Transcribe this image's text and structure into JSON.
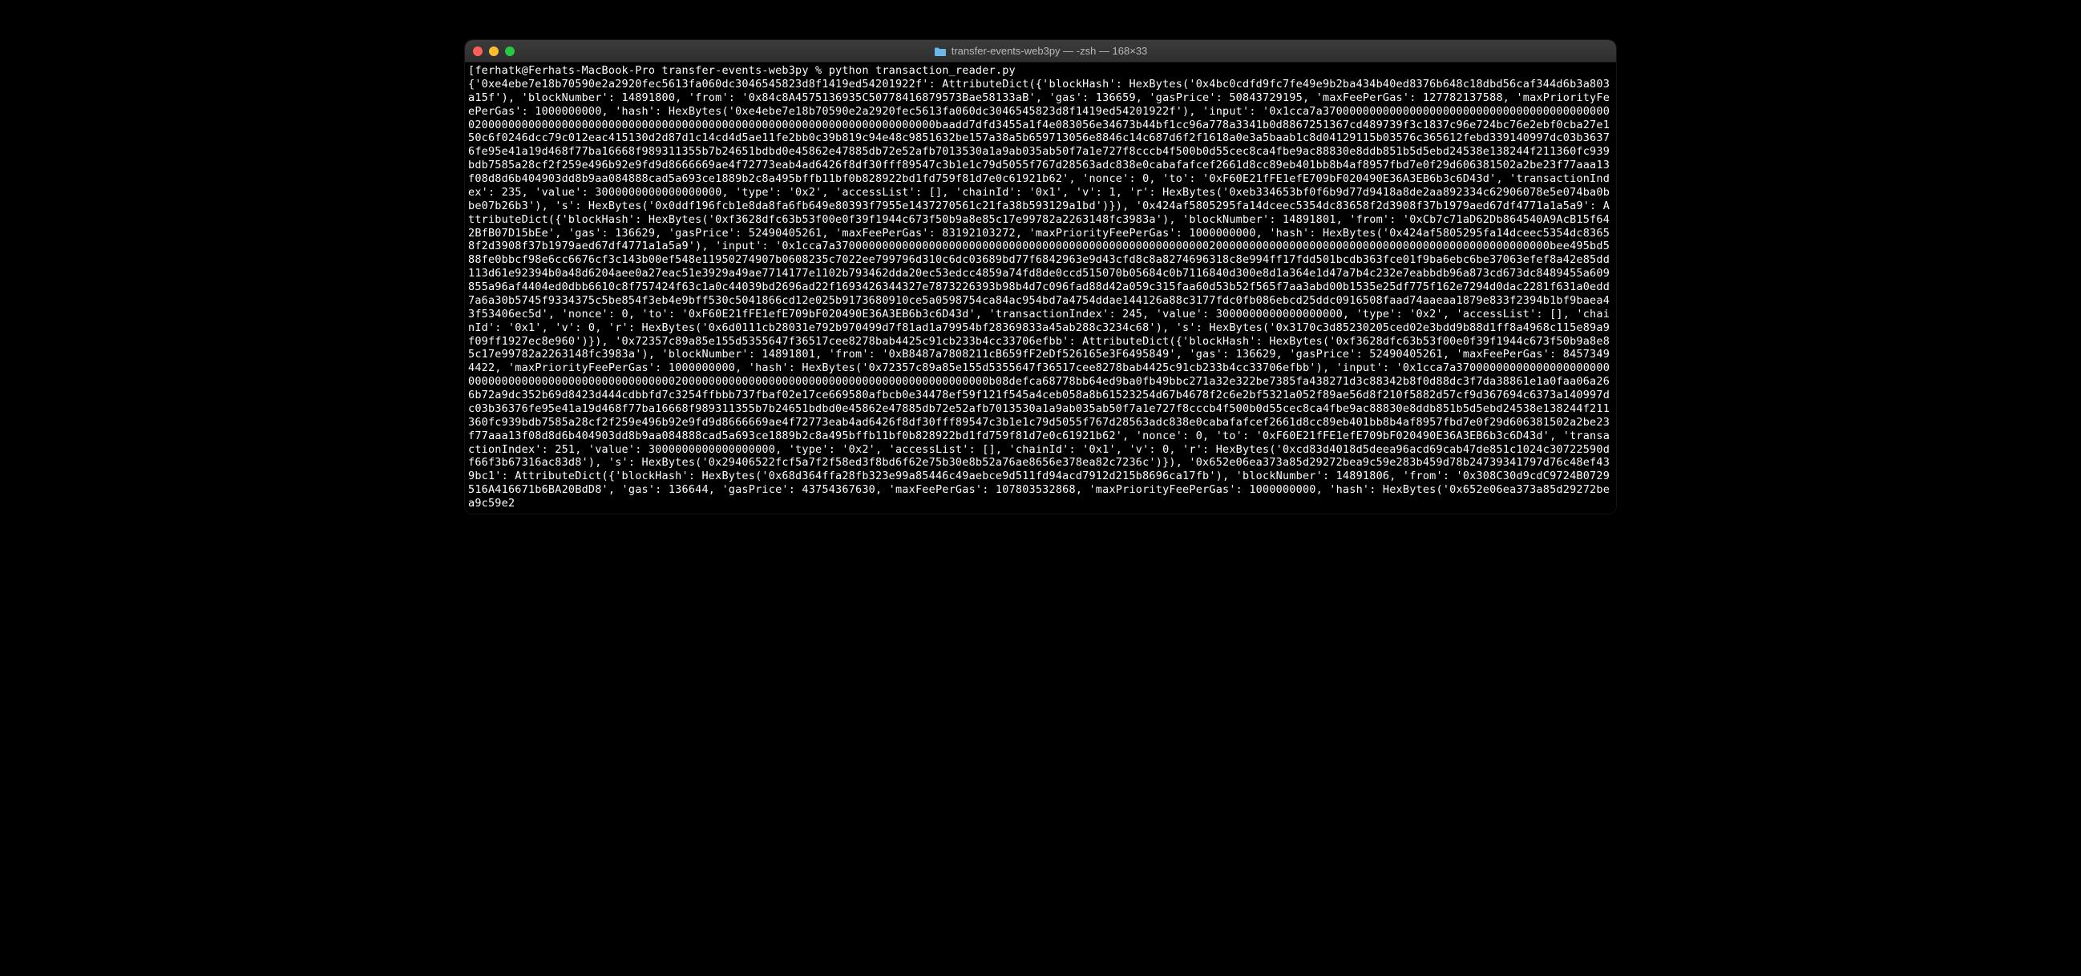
{
  "window": {
    "title": "transfer-events-web3py — -zsh — 168×33"
  },
  "terminal": {
    "prompt_line": "[ferhatk@Ferhats-MacBook-Pro transfer-events-web3py % python transaction_reader.py",
    "output": "{'0xe4ebe7e18b70590e2a2920fec5613fa060dc3046545823d8f1419ed54201922f': AttributeDict({'blockHash': HexBytes('0x4bc0cdfd9fc7fe49e9b2ba434b40ed8376b648c18dbd56caf344d6b3a803a15f'), 'blockNumber': 14891800, 'from': '0x84c8A4575136935C50778416879573Bae58133aB', 'gas': 136659, 'gasPrice': 50843729195, 'maxFeePerGas': 127782137588, 'maxPriorityFeePerGas': 1000000000, 'hash': HexBytes('0xe4ebe7e18b70590e2a2920fec5613fa060dc3046545823d8f1419ed54201922f'), 'input': '0x1cca7a37000000000000000000000000000000000000000000200000000000000000000000000000000000000000000000000000000000000000000baadd7dfd3455a1f4e083056e34673b44bf1cc96a778a3341b0d8867251367cd489739f3c1837c96e724bc76e2ebf0cba27e150c6f0246dcc79c012eac415130d2d87d1c14cd4d5ae11fe2bb0c39b819c94e48c9851632be157a38a5b659713056e8846c14c687d6f2f1618a0e3a5baab1c8d04129115b03576c365612febd339140997dc03b36376fe95e41a19d468f77ba16668f989311355b7b24651bdbd0e45862e47885db72e52afb7013530a1a9ab035ab50f7a1e727f8cccb4f500b0d55cec8ca4fbe9ac88830e8ddb851b5d5ebd24538e138244f211360fc939bdb7585a28cf2f259e496b92e9fd9d8666669ae4f72773eab4ad6426f8df30fff89547c3b1e1c79d5055f767d28563adc838e0cabafafcef2661d8cc89eb401bb8b4af8957fbd7e0f29d606381502a2be23f77aaa13f08d8d6b404903dd8b9aa084888cad5a693ce1889b2c8a495bffb11bf0b828922bd1fd759f81d7e0c61921b62', 'nonce': 0, 'to': '0xF60E21fFE1efE709bF020490E36A3EB6b3c6D43d', 'transactionIndex': 235, 'value': 3000000000000000000, 'type': '0x2', 'accessList': [], 'chainId': '0x1', 'v': 1, 'r': HexBytes('0xeb334653bf0f6b9d77d9418a8de2aa892334c62906078e5e074ba0bbe07b26b3'), 's': HexBytes('0x0ddf196fcb1e8da8fa6fb649e80393f7955e1437270561c21fa38b593129a1bd')}), '0x424af5805295fa14dceec5354dc83658f2d3908f37b1979aed67df4771a1a5a9': AttributeDict({'blockHash': HexBytes('0xf3628dfc63b53f00e0f39f1944c673f50b9a8e85c17e99782a2263148fc3983a'), 'blockNumber': 14891801, 'from': '0xCb7c71aD62Db864540A9AcB15f642BfB07D15bEe', 'gas': 136629, 'gasPrice': 52490405261, 'maxFeePerGas': 83192103272, 'maxPriorityFeePerGas': 1000000000, 'hash': HexBytes('0x424af5805295fa14dceec5354dc83658f2d3908f37b1979aed67df4771a1a5a9'), 'input': '0x1cca7a37000000000000000000000000000000000000000000000000000000200000000000000000000000000000000000000000000000000bee495bd588fe0bbcf98e6cc6676cf3c143b00ef548e11950274907b0608235c7022ee799796d310c6dc03689bd77f6842963e9d43cfd8c8a8274696318c8e994ff17fdd501bcdb363fce01f9ba6ebc6be37063efef8a42e85dd113d61e92394b0a48d6204aee0a27eac51e3929a49ae7714177e1102b793462dda20ec53edcc4859a74fd8de0ccd515070b05684c0b7116840d300e8d1a364e1d47a7b4c232e7eabbdb96a873cd673dc8489455a609855a96af4404ed0dbb6610c8f757424f63c1a0c44039bd2696ad22f1693426344327e7873226393b98b4d7c096fad88d42a059c315faa60d53b52f565f7aa3abd00b1535e25df775f162e7294d0dac2281f631a0edd7a6a30b5745f9334375c5be854f3eb4e9bff530c5041866cd12e025b9173680910ce5a0598754ca84ac954bd7a4754ddae144126a88c3177fdc0fb086ebcd25ddc0916508faad74aaeaa1879e833f2394b1bf9baea43f53406ec5d', 'nonce': 0, 'to': '0xF60E21fFE1efE709bF020490E36A3EB6b3c6D43d', 'transactionIndex': 245, 'value': 3000000000000000000, 'type': '0x2', 'accessList': [], 'chainId': '0x1', 'v': 0, 'r': HexBytes('0x6d0111cb28031e792b970499d7f81ad1a79954bf28369833a45ab288c3234c68'), 's': HexBytes('0x3170c3d85230205ced02e3bdd9b88d1ff8a4968c115e89a9f09ff1927ec8e960')}), '0x72357c89a85e155d5355647f36517cee8278bab4425c91cb233b4cc33706efbb': AttributeDict({'blockHash': HexBytes('0xf3628dfc63b53f00e0f39f1944c673f50b9a8e85c17e99782a2263148fc3983a'), 'blockNumber': 14891801, 'from': '0xB8487a7808211cB659fF2eDf526165e3F6495849', 'gas': 136629, 'gasPrice': 52490405261, 'maxFeePerGas': 84573494422, 'maxPriorityFeePerGas': 1000000000, 'hash': HexBytes('0x72357c89a85e155d5355647f36517cee8278bab4425c91cb233b4cc33706efbb'), 'input': '0x1cca7a37000000000000000000000000000000000000000000000000000020000000000000000000000000000000000000000000000b08defca68778bb64ed9ba0fb49bbc271a32e322be7385fa438271d3c88342b8f0d88dc3f7da38861e1a0faa06a266b72a9dc352b69d8423d444cdbbfd7c3254ffbbb737fbaf02e17ce669580afbcb0e34478ef59f121f545a4ceb058a8b61523254d67b4678f2c6e2bf5321a052f89ae56d8f210f5882d57cf9d367694c6373a140997dc03b36376fe95e41a19d468f77ba16668f989311355b7b24651bdbd0e45862e47885db72e52afb7013530a1a9ab035ab50f7a1e727f8cccb4f500b0d55cec8ca4fbe9ac88830e8ddb851b5d5ebd24538e138244f211360fc939bdb7585a28cf2f259e496b92e9fd9d8666669ae4f72773eab4ad6426f8df30fff89547c3b1e1c79d5055f767d28563adc838e0cabafafcef2661d8cc89eb401bb8b4af8957fbd7e0f29d606381502a2be23f77aaa13f08d8d6b404903dd8b9aa084888cad5a693ce1889b2c8a495bffb11bf0b828922bd1fd759f81d7e0c61921b62', 'nonce': 0, 'to': '0xF60E21fFE1efE709bF020490E36A3EB6b3c6D43d', 'transactionIndex': 251, 'value': 3000000000000000000, 'type': '0x2', 'accessList': [], 'chainId': '0x1', 'v': 0, 'r': HexBytes('0xcd83d4018d5deea96acd69cab47de851c1024c30722590df66f3b67316ac83d8'), 's': HexBytes('0x29406522fcf5a7f2f58ed3f8bd6f62e75b30e8b52a76ae8656e378ea82c7236c')}), '0x652e06ea373a85d29272bea9c59e283b459d78b24739341797d76c48ef439bc1': AttributeDict({'blockHash': HexBytes('0x68d364ffa28fb323e99a85446c49aebce9d511fd94acd7912d215b8696ca17fb'), 'blockNumber': 14891806, 'from': '0x308C30d9cdC9724B0729516A416671b6BA20BdD8', 'gas': 136644, 'gasPrice': 43754367630, 'maxFeePerGas': 107803532868, 'maxPriorityFeePerGas': 1000000000, 'hash': HexBytes('0x652e06ea373a85d29272bea9c59e2"
  }
}
